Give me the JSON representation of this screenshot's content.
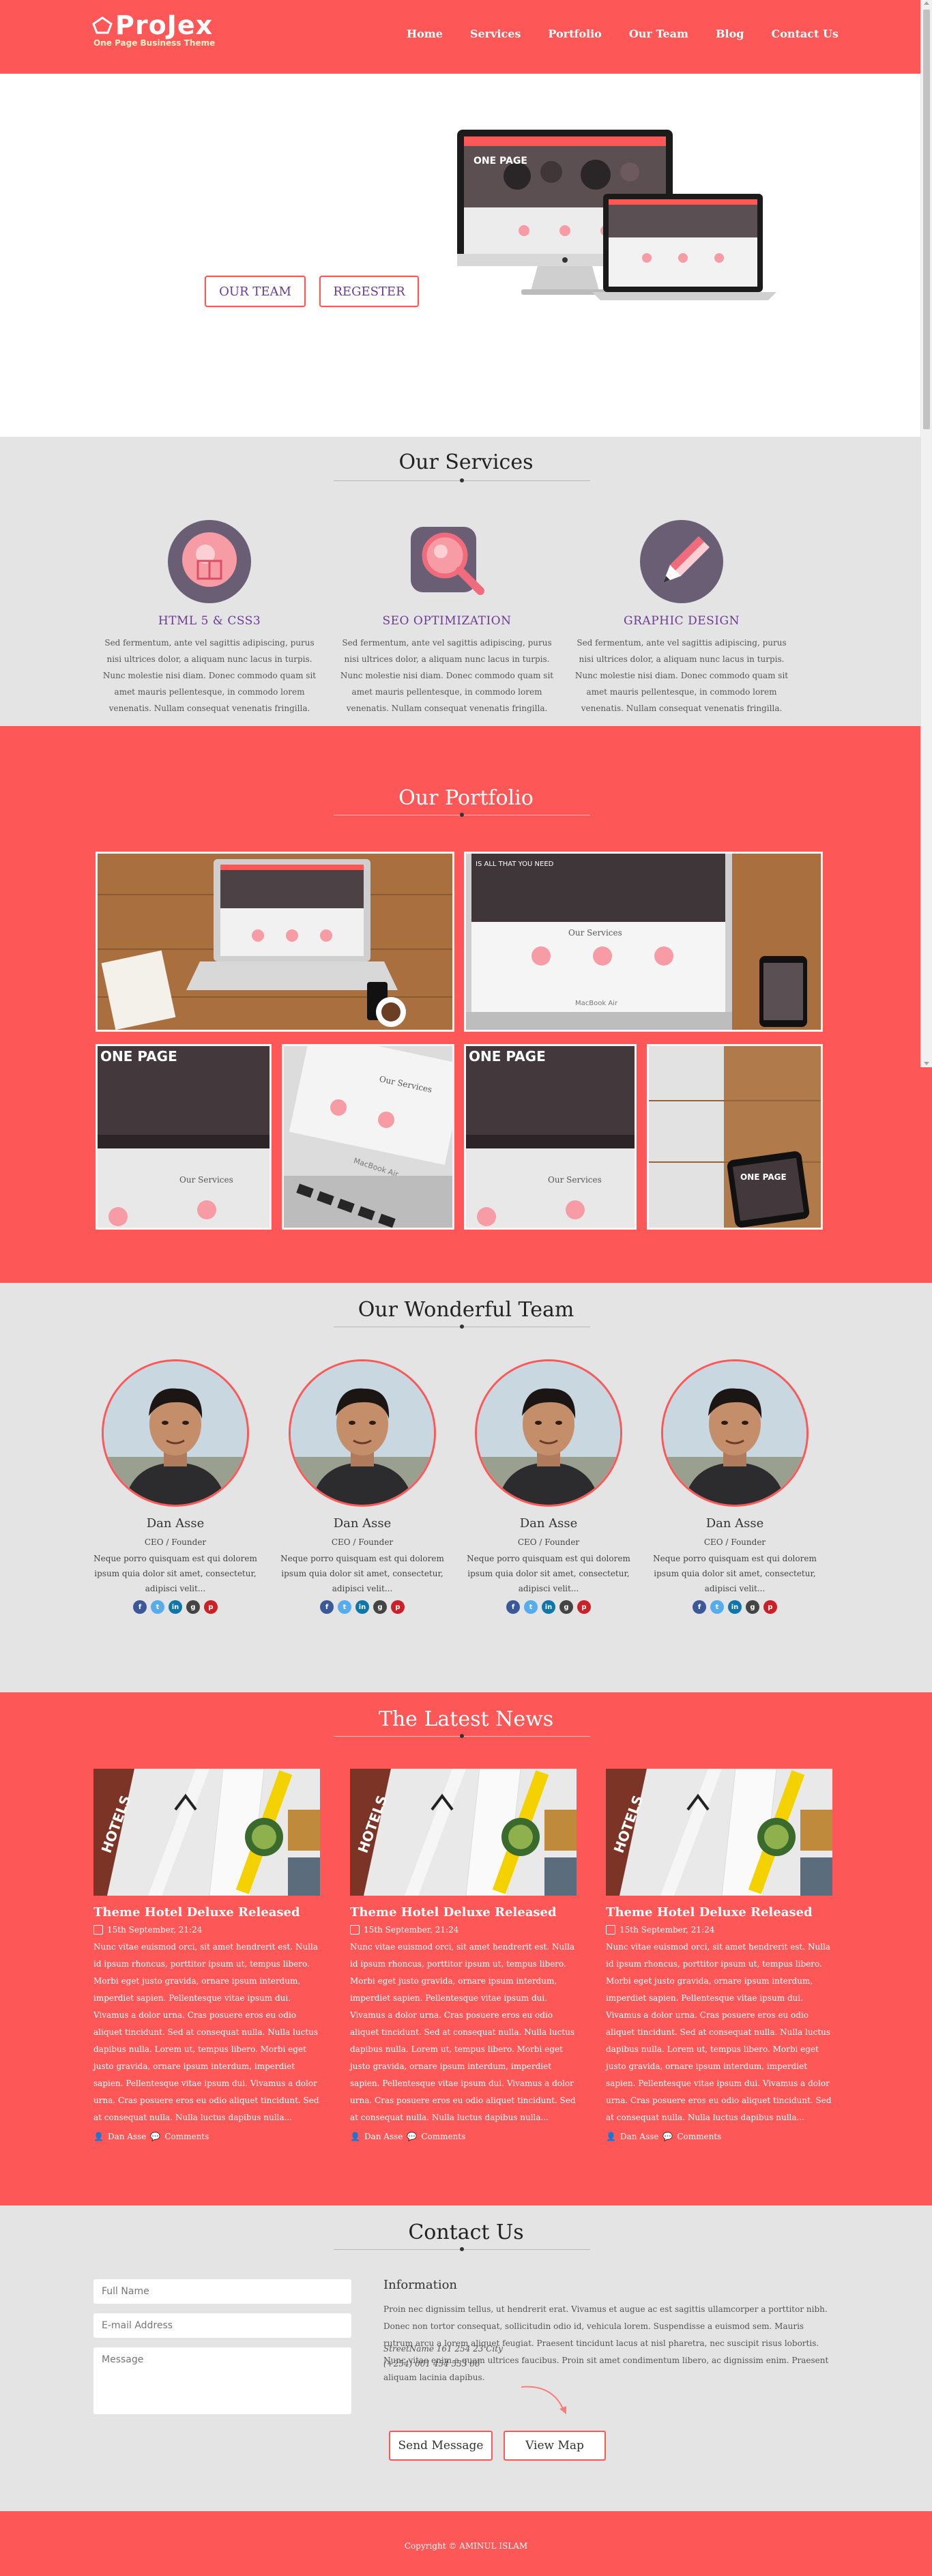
{
  "brand": {
    "name": "ProJex",
    "tagline": "One Page Business Theme",
    "logo_icon": "pentagon-icon"
  },
  "nav": {
    "items": [
      "Home",
      "Services",
      "Portfolio",
      "Our Team",
      "Blog",
      "Contact Us"
    ]
  },
  "hero": {
    "btn_team": "OUR TEAM",
    "btn_register": "REGESTER",
    "screen_headline": "ONE PAGE"
  },
  "services": {
    "title": "Our Services",
    "items": [
      {
        "name": "HTML 5 & CSS3",
        "icon": "html-icon",
        "text": "Sed fermentum, ante vel sagittis adipiscing, purus nisi ultrices dolor, a aliquam nunc lacus in turpis. Nunc molestie nisi diam. Donec commodo quam sit amet mauris pellentesque, in commodo lorem venenatis. Nullam consequat venenatis fringilla."
      },
      {
        "name": "SEO OPTIMIZATION",
        "icon": "magnifier-icon",
        "text": "Sed fermentum, ante vel sagittis adipiscing, purus nisi ultrices dolor, a aliquam nunc lacus in turpis. Nunc molestie nisi diam. Donec commodo quam sit amet mauris pellentesque, in commodo lorem venenatis. Nullam consequat venenatis fringilla."
      },
      {
        "name": "GRAPHIC DESIGN",
        "icon": "pencil-icon",
        "text": "Sed fermentum, ante vel sagittis adipiscing, purus nisi ultrices dolor, a aliquam nunc lacus in turpis. Nunc molestie nisi diam. Donec commodo quam sit amet mauris pellentesque, in commodo lorem venenatis. Nullam consequat venenatis fringilla."
      }
    ]
  },
  "portfolio": {
    "title": "Our Portfolio",
    "screen_heading": "Our Services",
    "screen_banner": "IS ALL THAT YOU NEED",
    "device_label": "MacBook Air"
  },
  "team": {
    "title": "Our Wonderful Team",
    "members": [
      {
        "name": "Dan Asse",
        "role": "CEO / Founder",
        "text": "Neque porro quisquam est qui dolorem ipsum quia dolor sit amet, consectetur, adipisci velit..."
      },
      {
        "name": "Dan Asse",
        "role": "CEO / Founder",
        "text": "Neque porro quisquam est qui dolorem ipsum quia dolor sit amet, consectetur, adipisci velit..."
      },
      {
        "name": "Dan Asse",
        "role": "CEO / Founder",
        "text": "Neque porro quisquam est qui dolorem ipsum quia dolor sit amet, consectetur, adipisci velit..."
      },
      {
        "name": "Dan Asse",
        "role": "CEO / Founder",
        "text": "Neque porro quisquam est qui dolorem ipsum quia dolor sit amet, consectetur, adipisci velit..."
      }
    ],
    "social_icons": [
      "facebook-icon",
      "twitter-icon",
      "linkedin-icon",
      "github-icon",
      "pinterest-icon"
    ]
  },
  "news": {
    "title": "The Latest News",
    "posts": [
      {
        "title": "Theme Hotel Deluxe Released",
        "date": "15th September, 21:24",
        "text": "Nunc vitae euismod orci, sit amet hendrerit est. Nulla id ipsum rhoncus, porttitor ipsum ut, tempus libero. Morbi eget justo gravida, ornare ipsum interdum, imperdiet sapien. Pellentesque vitae ipsum dui. Vivamus a dolor urna. Cras posuere eros eu odio aliquet tincidunt. Sed at consequat nulla. Nulla luctus dapibus nulla. Lorem ut, tempus libero. Morbi eget justo gravida, ornare ipsum interdum, imperdiet sapien. Pellentesque vitae ipsum dui. Vivamus a dolor urna. Cras posuere eros eu odio aliquet tincidunt. Sed at consequat nulla. Nulla luctus dapibus nulla...",
        "author": "Dan Asse",
        "comments": "Comments",
        "image_text": "HOTELS"
      },
      {
        "title": "Theme Hotel Deluxe Released",
        "date": "15th September, 21:24",
        "text": "Nunc vitae euismod orci, sit amet hendrerit est. Nulla id ipsum rhoncus, porttitor ipsum ut, tempus libero. Morbi eget justo gravida, ornare ipsum interdum, imperdiet sapien. Pellentesque vitae ipsum dui. Vivamus a dolor urna. Cras posuere eros eu odio aliquet tincidunt. Sed at consequat nulla. Nulla luctus dapibus nulla. Lorem ut, tempus libero. Morbi eget justo gravida, ornare ipsum interdum, imperdiet sapien. Pellentesque vitae ipsum dui. Vivamus a dolor urna. Cras posuere eros eu odio aliquet tincidunt. Sed at consequat nulla. Nulla luctus dapibus nulla...",
        "author": "Dan Asse",
        "comments": "Comments",
        "image_text": "HOTELS"
      },
      {
        "title": "Theme Hotel Deluxe Released",
        "date": "15th September, 21:24",
        "text": "Nunc vitae euismod orci, sit amet hendrerit est. Nulla id ipsum rhoncus, porttitor ipsum ut, tempus libero. Morbi eget justo gravida, ornare ipsum interdum, imperdiet sapien. Pellentesque vitae ipsum dui. Vivamus a dolor urna. Cras posuere eros eu odio aliquet tincidunt. Sed at consequat nulla. Nulla luctus dapibus nulla. Lorem ut, tempus libero. Morbi eget justo gravida, ornare ipsum interdum, imperdiet sapien. Pellentesque vitae ipsum dui. Vivamus a dolor urna. Cras posuere eros eu odio aliquet tincidunt. Sed at consequat nulla. Nulla luctus dapibus nulla...",
        "author": "Dan Asse",
        "comments": "Comments",
        "image_text": "HOTELS"
      }
    ]
  },
  "contact": {
    "title": "Contact Us",
    "name_placeholder": "Full Name",
    "email_placeholder": "E-mail Address",
    "message_placeholder": "Message",
    "info_title": "Information",
    "info_text": "Proin nec dignissim tellus, ut hendrerit erat. Vivamus et augue ac est sagittis ullamcorper a porttitor nibh. Donec non tortor consequat, sollicitudin odio id, vehicula lorem. Suspendisse a euismod sem. Mauris rutrum arcu a lorem aliquet feugiat. Praesent tincidunt lacus at nisl pharetra, nec suscipit risus lobortis. Nunc vitae enim a quam ultrices faucibus. Proin sit amet condimentum libero, ac dignissim enim. Praesent aliquam lacinia dapibus.",
    "address": "StreetName 161 254 23 City",
    "phone": "(+254) 001 454 533 66",
    "send_label": "Send Message",
    "map_label": "View Map"
  },
  "footer": {
    "copyright": "Copyright © AMINUL ISLAM"
  },
  "colors": {
    "accent": "#fe5757",
    "section_gray": "#e4e4e4",
    "purple_text": "#6b3a96",
    "pink_icon": "#f79ba5"
  }
}
